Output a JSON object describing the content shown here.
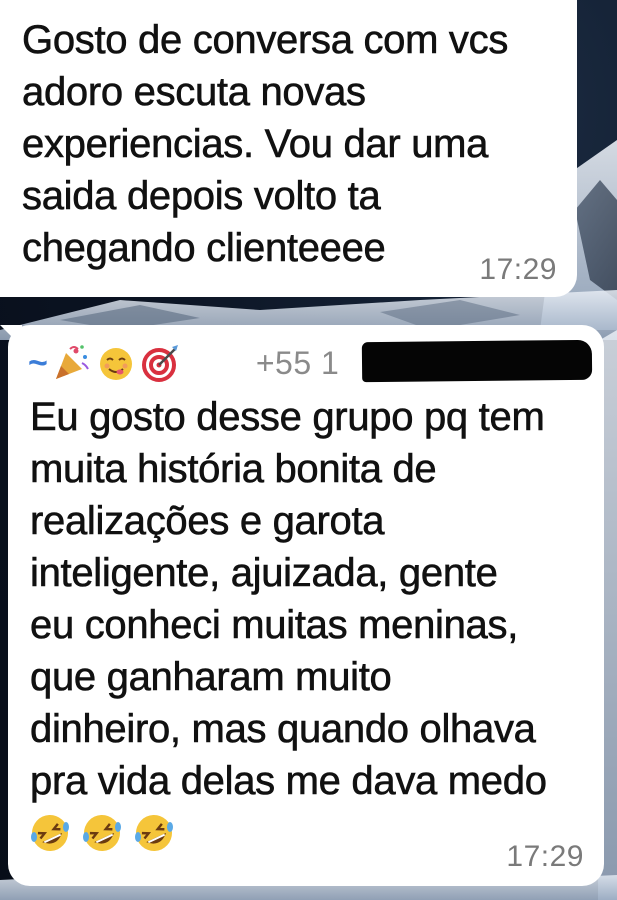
{
  "messages": [
    {
      "text": "Gosto de conversa com vcs\nadoro escuta novas\nexperiencias. Vou dar uma\nsaida depois volto ta\nchegando clienteeee",
      "time": "17:29"
    },
    {
      "sender": {
        "prefix": "~",
        "emojis": [
          "party-popper-icon",
          "face-savoring-icon",
          "direct-hit-icon"
        ],
        "phone": "+55 1"
      },
      "text": "Eu gosto desse grupo pq tem\nmuita história bonita de\nrealizações e garota\ninteligente, ajuizada, gente\neu conheci muitas meninas,\nque ganharam muito\ndinheiro, mas quando olhava\npra vida delas me dava medo",
      "reactions": [
        "rolling-on-floor-laughing-icon",
        "rolling-on-floor-laughing-icon",
        "rolling-on-floor-laughing-icon"
      ],
      "time": "17:29"
    }
  ],
  "colors": {
    "bubble": "#ffffff",
    "text": "#111111",
    "time": "#7a7a7a",
    "sender_prefix": "#3b7dd8",
    "wallpaper": "#0b1322"
  }
}
